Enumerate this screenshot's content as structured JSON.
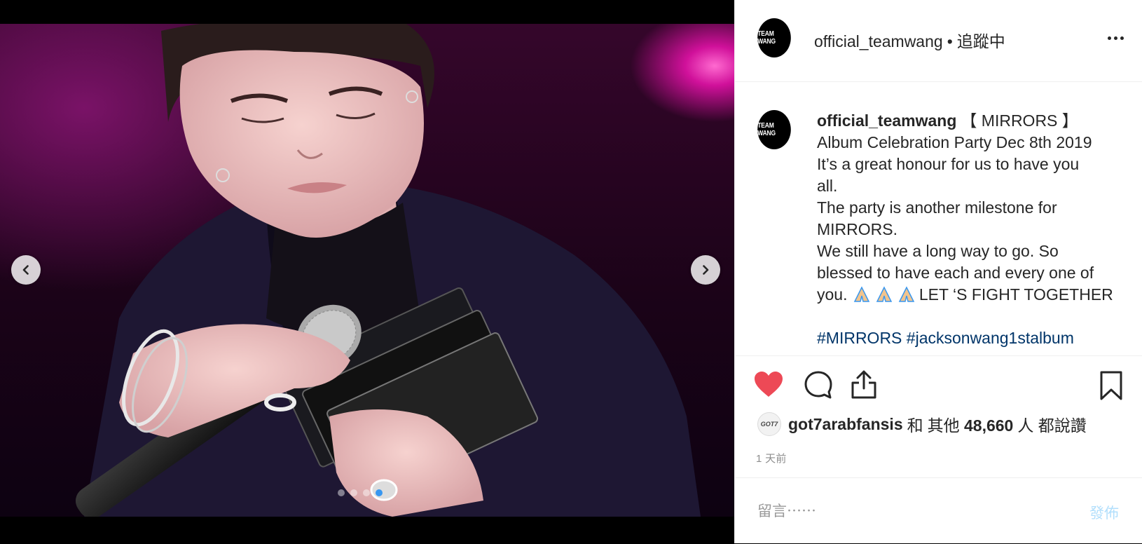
{
  "post": {
    "username": "official_teamwang",
    "avatar_text": "TEAM WANG",
    "follow_separator": "•",
    "follow_status": "追蹤中",
    "caption_lines": [
      "【 MIRRORS 】",
      "Album Celebration Party Dec 8th 2019",
      "It’s a great honour for us to have you",
      "all.",
      "The party is another milestone for",
      "MIRRORS.",
      "We still have a long way to go. So",
      "blessed to have each and every one of",
      "you.",
      "LET ‘S FIGHT TOGETHER"
    ],
    "hashtags": [
      "#MIRRORS",
      "#jacksonwang1stalbum"
    ],
    "likes": {
      "avatar_text": "GOT7",
      "first_user": "got7arabfansis",
      "connector": "和",
      "others_prefix": "其他",
      "count": "48,660",
      "suffix": "人 都說讚"
    },
    "timestamp": "1 天前",
    "comment": {
      "placeholder": "留言⋯⋯",
      "post_label": "發佈"
    }
  },
  "carousel": {
    "total": 4,
    "active_index": 3
  },
  "icons": {
    "like": "heart-icon",
    "comment": "comment-icon",
    "share": "share-icon",
    "save": "bookmark-icon",
    "more": "more-icon",
    "prev": "chevron-left-icon",
    "next": "chevron-right-icon",
    "emoji": "folded-hands-icon"
  },
  "colors": {
    "like": "#ed4956",
    "hashtag": "#003569",
    "post_button": "#b2dffc",
    "dot_active": "#3897f0"
  }
}
